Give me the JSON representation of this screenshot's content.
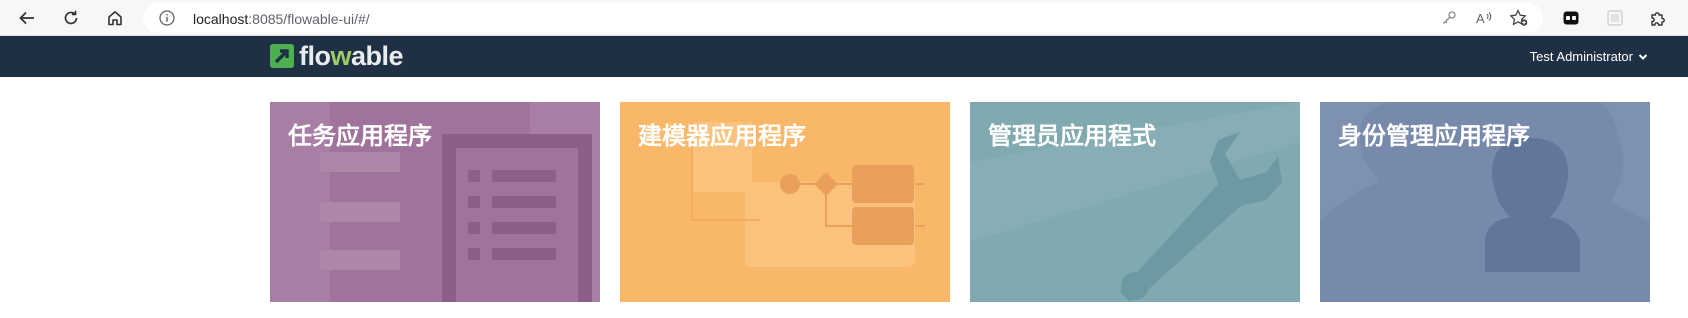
{
  "browser": {
    "url_host": "localhost",
    "url_rest": ":8085/flowable-ui/#/"
  },
  "header": {
    "logo_text_main": "flo",
    "logo_text_accent": "w",
    "logo_text_end": "able",
    "user_name": "Test Administrator"
  },
  "tiles": [
    {
      "title": "任务应用程序",
      "color": "#a0739c"
    },
    {
      "title": "建模器应用程序",
      "color": "#f9b869"
    },
    {
      "title": "管理员应用程式",
      "color": "#80a9b0"
    },
    {
      "title": "身份管理应用程序",
      "color": "#788aab"
    }
  ],
  "colors": {
    "header_bg": "#1f3044",
    "logo_green": "#4caf50"
  }
}
